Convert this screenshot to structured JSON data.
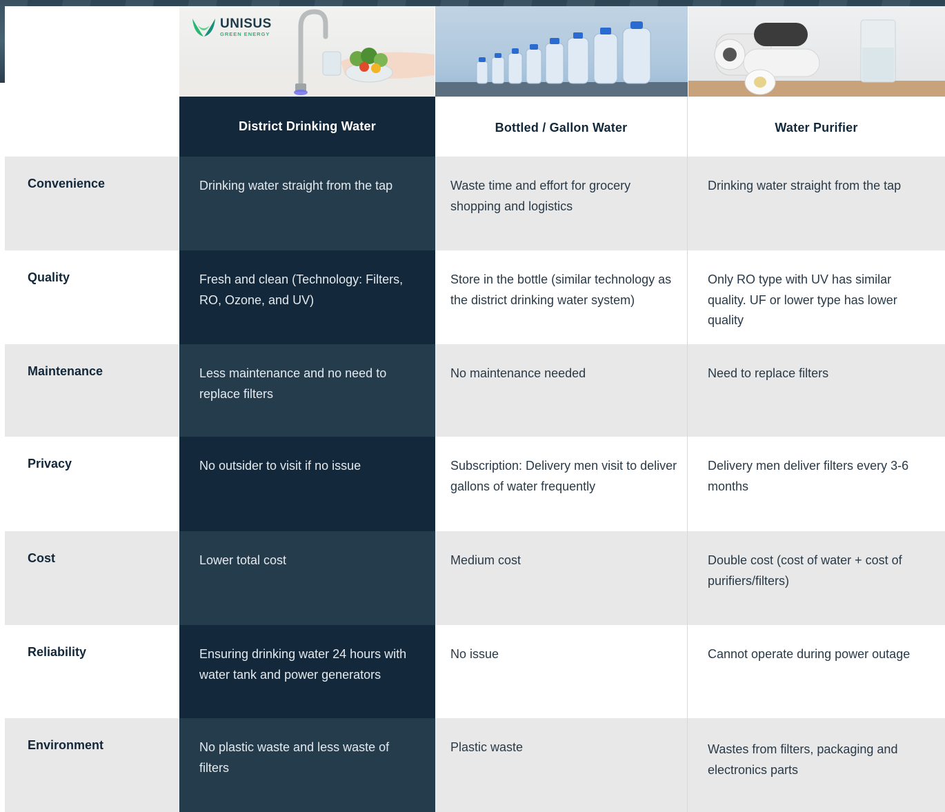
{
  "logo": {
    "name": "UNISUS",
    "tagline": "GREEN ENERGY"
  },
  "columns": [
    {
      "title": "District Drinking Water"
    },
    {
      "title": "Bottled / Gallon Water"
    },
    {
      "title": "Water Purifier"
    }
  ],
  "rows": [
    {
      "label": "Convenience",
      "values": [
        "Drinking water straight from the tap",
        "Waste time and effort for grocery shopping and logistics",
        "Drinking water straight from the tap"
      ]
    },
    {
      "label": "Quality",
      "values": [
        "Fresh and clean (Technology: Filters, RO, Ozone, and UV)",
        "Store in the bottle (similar technology as the district drinking water system)",
        "Only RO type with UV has similar quality. UF or lower type has lower quality"
      ]
    },
    {
      "label": "Maintenance",
      "values": [
        "Less maintenance and no need to replace filters",
        "No maintenance needed",
        "Need to replace filters"
      ]
    },
    {
      "label": "Privacy",
      "values": [
        "No outsider to visit if no issue",
        "Subscription: Delivery men visit to deliver gallons of water frequently",
        "Delivery men deliver filters every 3-6 months"
      ]
    },
    {
      "label": "Cost",
      "values": [
        "Lower total cost",
        "Medium cost",
        "Double cost (cost of water + cost of purifiers/filters)"
      ]
    },
    {
      "label": "Reliability",
      "values": [
        "Ensuring drinking water 24 hours with water tank and power generators",
        "No issue",
        "Cannot operate during power outage"
      ]
    },
    {
      "label": "Environment",
      "values": [
        "No plastic waste and less waste of filters",
        "Plastic waste",
        "Wastes from filters, packaging and electronics parts"
      ]
    }
  ],
  "colors": {
    "highlight_dark": "#13283a",
    "highlight_light": "#253c4d",
    "row_gray": "#e7e8e7",
    "brand_green": "#2bb673"
  }
}
